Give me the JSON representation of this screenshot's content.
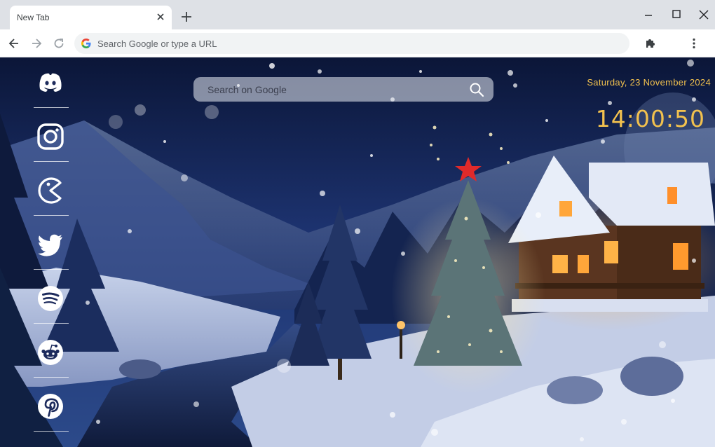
{
  "browser": {
    "tab_title": "New Tab",
    "omnibox_placeholder": "Search Google or type a URL"
  },
  "sidebar": {
    "items": [
      {
        "name": "Discord",
        "icon": "discord-icon"
      },
      {
        "name": "Instagram",
        "icon": "instagram-icon"
      },
      {
        "name": "Pac-Man",
        "icon": "pacman-icon"
      },
      {
        "name": "Twitter",
        "icon": "twitter-icon"
      },
      {
        "name": "Spotify",
        "icon": "spotify-icon"
      },
      {
        "name": "Reddit",
        "icon": "reddit-icon"
      },
      {
        "name": "Pinterest",
        "icon": "pinterest-icon"
      }
    ]
  },
  "search": {
    "placeholder": "Search on Google"
  },
  "clock": {
    "date": "Saturday, 23 November 2024",
    "time": "14:00:50"
  },
  "colors": {
    "accent_clock": "#f2c14e",
    "toolbar_bg": "#ffffff",
    "tabstrip_bg": "#dee1e6"
  }
}
